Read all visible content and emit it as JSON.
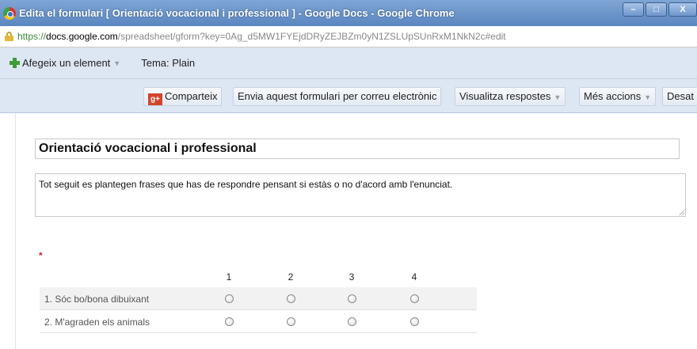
{
  "window": {
    "title": "Edita el formulari [ Orientació vocacional i professional ] - Google Docs - Google Chrome",
    "controls": [
      "–",
      "□",
      "X"
    ]
  },
  "address": {
    "scheme": "https://",
    "host": "docs.google.com",
    "path": "/spreadsheet/gform?key=0Ag_d5MW1FYEjdDRyZEJBZm0yN1ZSLUpSUnRxM1NkN2c#edit"
  },
  "toolbar1": {
    "add_label": "Afegeix un element",
    "theme_label": "Tema: Plain"
  },
  "toolbar2": {
    "gplus_glyph": "g+",
    "share_label": "Comparteix",
    "email_label": "Envia aquest formulari per correu electrònic",
    "responses_label": "Visualitza respostes",
    "more_label": "Més accions",
    "cut_label": "Desat"
  },
  "form": {
    "title": "Orientació vocacional i professional",
    "description": "Tot seguit es plantegen frases que has de respondre pensant si estàs o no d'acord amb l'enunciat.",
    "required_mark": "*",
    "grid": {
      "columns": [
        "1",
        "2",
        "3",
        "4"
      ],
      "rows": [
        "1. Sóc bo/bona dibuixant",
        "2. M'agraden els animals"
      ]
    }
  }
}
